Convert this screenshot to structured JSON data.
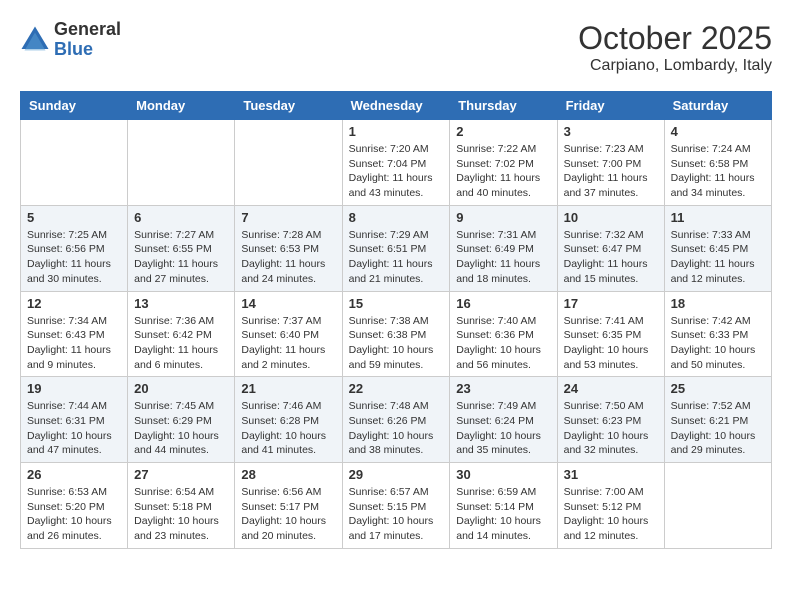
{
  "logo": {
    "general": "General",
    "blue": "Blue"
  },
  "title": "October 2025",
  "location": "Carpiano, Lombardy, Italy",
  "days_header": [
    "Sunday",
    "Monday",
    "Tuesday",
    "Wednesday",
    "Thursday",
    "Friday",
    "Saturday"
  ],
  "weeks": [
    [
      {
        "day": "",
        "info": ""
      },
      {
        "day": "",
        "info": ""
      },
      {
        "day": "",
        "info": ""
      },
      {
        "day": "1",
        "info": "Sunrise: 7:20 AM\nSunset: 7:04 PM\nDaylight: 11 hours\nand 43 minutes."
      },
      {
        "day": "2",
        "info": "Sunrise: 7:22 AM\nSunset: 7:02 PM\nDaylight: 11 hours\nand 40 minutes."
      },
      {
        "day": "3",
        "info": "Sunrise: 7:23 AM\nSunset: 7:00 PM\nDaylight: 11 hours\nand 37 minutes."
      },
      {
        "day": "4",
        "info": "Sunrise: 7:24 AM\nSunset: 6:58 PM\nDaylight: 11 hours\nand 34 minutes."
      }
    ],
    [
      {
        "day": "5",
        "info": "Sunrise: 7:25 AM\nSunset: 6:56 PM\nDaylight: 11 hours\nand 30 minutes."
      },
      {
        "day": "6",
        "info": "Sunrise: 7:27 AM\nSunset: 6:55 PM\nDaylight: 11 hours\nand 27 minutes."
      },
      {
        "day": "7",
        "info": "Sunrise: 7:28 AM\nSunset: 6:53 PM\nDaylight: 11 hours\nand 24 minutes."
      },
      {
        "day": "8",
        "info": "Sunrise: 7:29 AM\nSunset: 6:51 PM\nDaylight: 11 hours\nand 21 minutes."
      },
      {
        "day": "9",
        "info": "Sunrise: 7:31 AM\nSunset: 6:49 PM\nDaylight: 11 hours\nand 18 minutes."
      },
      {
        "day": "10",
        "info": "Sunrise: 7:32 AM\nSunset: 6:47 PM\nDaylight: 11 hours\nand 15 minutes."
      },
      {
        "day": "11",
        "info": "Sunrise: 7:33 AM\nSunset: 6:45 PM\nDaylight: 11 hours\nand 12 minutes."
      }
    ],
    [
      {
        "day": "12",
        "info": "Sunrise: 7:34 AM\nSunset: 6:43 PM\nDaylight: 11 hours\nand 9 minutes."
      },
      {
        "day": "13",
        "info": "Sunrise: 7:36 AM\nSunset: 6:42 PM\nDaylight: 11 hours\nand 6 minutes."
      },
      {
        "day": "14",
        "info": "Sunrise: 7:37 AM\nSunset: 6:40 PM\nDaylight: 11 hours\nand 2 minutes."
      },
      {
        "day": "15",
        "info": "Sunrise: 7:38 AM\nSunset: 6:38 PM\nDaylight: 10 hours\nand 59 minutes."
      },
      {
        "day": "16",
        "info": "Sunrise: 7:40 AM\nSunset: 6:36 PM\nDaylight: 10 hours\nand 56 minutes."
      },
      {
        "day": "17",
        "info": "Sunrise: 7:41 AM\nSunset: 6:35 PM\nDaylight: 10 hours\nand 53 minutes."
      },
      {
        "day": "18",
        "info": "Sunrise: 7:42 AM\nSunset: 6:33 PM\nDaylight: 10 hours\nand 50 minutes."
      }
    ],
    [
      {
        "day": "19",
        "info": "Sunrise: 7:44 AM\nSunset: 6:31 PM\nDaylight: 10 hours\nand 47 minutes."
      },
      {
        "day": "20",
        "info": "Sunrise: 7:45 AM\nSunset: 6:29 PM\nDaylight: 10 hours\nand 44 minutes."
      },
      {
        "day": "21",
        "info": "Sunrise: 7:46 AM\nSunset: 6:28 PM\nDaylight: 10 hours\nand 41 minutes."
      },
      {
        "day": "22",
        "info": "Sunrise: 7:48 AM\nSunset: 6:26 PM\nDaylight: 10 hours\nand 38 minutes."
      },
      {
        "day": "23",
        "info": "Sunrise: 7:49 AM\nSunset: 6:24 PM\nDaylight: 10 hours\nand 35 minutes."
      },
      {
        "day": "24",
        "info": "Sunrise: 7:50 AM\nSunset: 6:23 PM\nDaylight: 10 hours\nand 32 minutes."
      },
      {
        "day": "25",
        "info": "Sunrise: 7:52 AM\nSunset: 6:21 PM\nDaylight: 10 hours\nand 29 minutes."
      }
    ],
    [
      {
        "day": "26",
        "info": "Sunrise: 6:53 AM\nSunset: 5:20 PM\nDaylight: 10 hours\nand 26 minutes."
      },
      {
        "day": "27",
        "info": "Sunrise: 6:54 AM\nSunset: 5:18 PM\nDaylight: 10 hours\nand 23 minutes."
      },
      {
        "day": "28",
        "info": "Sunrise: 6:56 AM\nSunset: 5:17 PM\nDaylight: 10 hours\nand 20 minutes."
      },
      {
        "day": "29",
        "info": "Sunrise: 6:57 AM\nSunset: 5:15 PM\nDaylight: 10 hours\nand 17 minutes."
      },
      {
        "day": "30",
        "info": "Sunrise: 6:59 AM\nSunset: 5:14 PM\nDaylight: 10 hours\nand 14 minutes."
      },
      {
        "day": "31",
        "info": "Sunrise: 7:00 AM\nSunset: 5:12 PM\nDaylight: 10 hours\nand 12 minutes."
      },
      {
        "day": "",
        "info": ""
      }
    ]
  ]
}
